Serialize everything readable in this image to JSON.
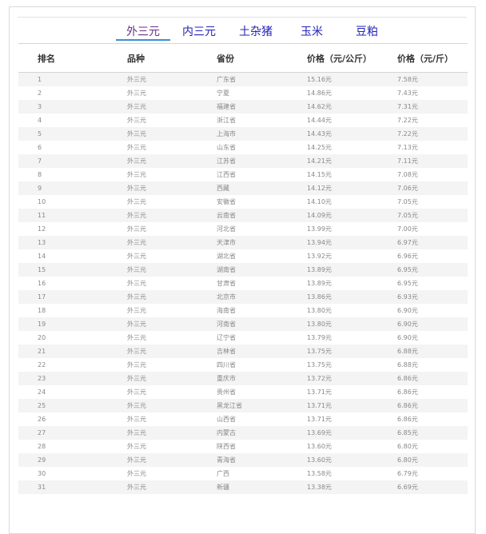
{
  "tabs": [
    "外三元",
    "内三元",
    "土杂猪",
    "玉米",
    "豆粕"
  ],
  "active_tab": 0,
  "columns": [
    "排名",
    "品种",
    "省份",
    "价格（元/公斤）",
    "价格（元/斤）"
  ],
  "rows": [
    [
      "1",
      "外三元",
      "广东省",
      "15.16元",
      "7.58元"
    ],
    [
      "2",
      "外三元",
      "宁夏",
      "14.86元",
      "7.43元"
    ],
    [
      "3",
      "外三元",
      "福建省",
      "14.62元",
      "7.31元"
    ],
    [
      "4",
      "外三元",
      "浙江省",
      "14.44元",
      "7.22元"
    ],
    [
      "5",
      "外三元",
      "上海市",
      "14.43元",
      "7.22元"
    ],
    [
      "6",
      "外三元",
      "山东省",
      "14.25元",
      "7.13元"
    ],
    [
      "7",
      "外三元",
      "江苏省",
      "14.21元",
      "7.11元"
    ],
    [
      "8",
      "外三元",
      "江西省",
      "14.15元",
      "7.08元"
    ],
    [
      "9",
      "外三元",
      "西藏",
      "14.12元",
      "7.06元"
    ],
    [
      "10",
      "外三元",
      "安徽省",
      "14.10元",
      "7.05元"
    ],
    [
      "11",
      "外三元",
      "云南省",
      "14.09元",
      "7.05元"
    ],
    [
      "12",
      "外三元",
      "河北省",
      "13.99元",
      "7.00元"
    ],
    [
      "13",
      "外三元",
      "天津市",
      "13.94元",
      "6.97元"
    ],
    [
      "14",
      "外三元",
      "湖北省",
      "13.92元",
      "6.96元"
    ],
    [
      "15",
      "外三元",
      "湖南省",
      "13.89元",
      "6.95元"
    ],
    [
      "16",
      "外三元",
      "甘肃省",
      "13.89元",
      "6.95元"
    ],
    [
      "17",
      "外三元",
      "北京市",
      "13.86元",
      "6.93元"
    ],
    [
      "18",
      "外三元",
      "海南省",
      "13.80元",
      "6.90元"
    ],
    [
      "19",
      "外三元",
      "河南省",
      "13.80元",
      "6.90元"
    ],
    [
      "20",
      "外三元",
      "辽宁省",
      "13.79元",
      "6.90元"
    ],
    [
      "21",
      "外三元",
      "吉林省",
      "13.75元",
      "6.88元"
    ],
    [
      "22",
      "外三元",
      "四川省",
      "13.75元",
      "6.88元"
    ],
    [
      "23",
      "外三元",
      "重庆市",
      "13.72元",
      "6.86元"
    ],
    [
      "24",
      "外三元",
      "贵州省",
      "13.71元",
      "6.86元"
    ],
    [
      "25",
      "外三元",
      "黑龙江省",
      "13.71元",
      "6.86元"
    ],
    [
      "26",
      "外三元",
      "山西省",
      "13.71元",
      "6.86元"
    ],
    [
      "27",
      "外三元",
      "内蒙古",
      "13.69元",
      "6.85元"
    ],
    [
      "28",
      "外三元",
      "陕西省",
      "13.60元",
      "6.80元"
    ],
    [
      "29",
      "外三元",
      "青海省",
      "13.60元",
      "6.80元"
    ],
    [
      "30",
      "外三元",
      "广西",
      "13.58元",
      "6.79元"
    ],
    [
      "31",
      "外三元",
      "新疆",
      "13.38元",
      "6.69元"
    ]
  ]
}
